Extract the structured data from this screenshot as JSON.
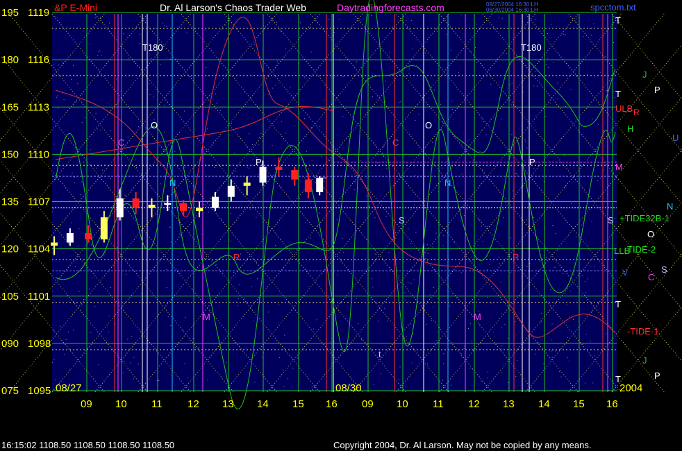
{
  "header": {
    "symbol": "&P E-Mini",
    "title": "Dr. Al Larson's Chaos Trader Web",
    "site": "Daytradingforecasts.com",
    "timestamp_1": "08/27/2004 16:30:LH",
    "timestamp_2": "08/30/2004 16:30:LH",
    "file": "spcctom.txt"
  },
  "footer": {
    "quote": "16:15:02  1108.50 1108.50 1108.50 1108.50",
    "copyright": "Copyright 2004, Dr. Al Larson. May not be copied by any means."
  },
  "colors": {
    "background": "#00005c",
    "price_up": "#ffffff",
    "price_down": "#ff2020",
    "price_yellow": "#ffff60",
    "green_line": "#20c020",
    "red_line": "#e03030",
    "yellow_grid": "#e0e060",
    "axis_text": "#ffff00"
  },
  "chart_data": {
    "type": "line",
    "title": "",
    "y_left_outer": [
      "195",
      "180",
      "165",
      "150",
      "135",
      "120",
      "105",
      "090",
      "075"
    ],
    "y_left_inner": [
      "1119",
      "1116",
      "1113",
      "1110",
      "1107",
      "1104",
      "1101",
      "1098",
      "1095"
    ],
    "ylim": [
      1095,
      1119
    ],
    "x_tick_labels": [
      "09",
      "10",
      "11",
      "12",
      "13",
      "14",
      "15",
      "16",
      "09",
      "10",
      "11",
      "12",
      "13",
      "14",
      "15",
      "16"
    ],
    "date_labels": [
      "08/27",
      "08/30",
      "2004"
    ],
    "legend_right": [
      {
        "text": "T",
        "color": "#ffffff"
      },
      {
        "text": "J",
        "color": "#20c020"
      },
      {
        "text": "P",
        "color": "#ffffff"
      },
      {
        "text": "T",
        "color": "#ffffff"
      },
      {
        "text": "ULB",
        "color": "#ff3030"
      },
      {
        "text": "R",
        "color": "#ff3030"
      },
      {
        "text": "H",
        "color": "#20e020"
      },
      {
        "text": "U",
        "color": "#4060ff"
      },
      {
        "text": "M",
        "color": "#ff40ff"
      },
      {
        "text": "N",
        "color": "#20c0ff"
      },
      {
        "text": "+TIDE32B-1",
        "color": "#20e020"
      },
      {
        "text": "O",
        "color": "#ffffff"
      },
      {
        "text": "LLB",
        "color": "#20e020"
      },
      {
        "text": "TIDE-2",
        "color": "#20e020"
      },
      {
        "text": "V",
        "color": "#4060ff"
      },
      {
        "text": "S",
        "color": "#c0c0ff"
      },
      {
        "text": "C",
        "color": "#ff40ff"
      },
      {
        "text": "T",
        "color": "#ffffff"
      },
      {
        "text": "-TIDE-1",
        "color": "#ff3030"
      },
      {
        "text": "J",
        "color": "#20c020"
      },
      {
        "text": "T",
        "color": "#ffffff"
      },
      {
        "text": "P",
        "color": "#ffffff"
      }
    ],
    "annotations": [
      "T180",
      "T180",
      "O",
      "O",
      "N",
      "N",
      "P",
      "P",
      "M",
      "M",
      "C",
      "C",
      "S",
      "S",
      "R",
      "R",
      "t"
    ],
    "series": [
      {
        "type": "candles",
        "values": [
          {
            "t": 0.0,
            "o": 1104.2,
            "h": 1104.8,
            "l": 1103.6,
            "c": 1104.4
          },
          {
            "t": 0.35,
            "o": 1104.4,
            "h": 1105.3,
            "l": 1104.2,
            "c": 1105.0
          },
          {
            "t": 0.75,
            "o": 1105.0,
            "h": 1105.5,
            "l": 1104.4,
            "c": 1104.6
          },
          {
            "t": 1.1,
            "o": 1104.6,
            "h": 1106.4,
            "l": 1104.4,
            "c": 1106.0
          },
          {
            "t": 1.45,
            "o": 1106.0,
            "h": 1107.8,
            "l": 1105.8,
            "c": 1107.2
          },
          {
            "t": 1.8,
            "o": 1107.2,
            "h": 1107.6,
            "l": 1106.2,
            "c": 1106.6
          },
          {
            "t": 2.15,
            "o": 1106.6,
            "h": 1107.2,
            "l": 1106.0,
            "c": 1106.8
          },
          {
            "t": 2.5,
            "o": 1106.8,
            "h": 1107.4,
            "l": 1106.4,
            "c": 1106.9
          },
          {
            "t": 2.85,
            "o": 1106.9,
            "h": 1107.1,
            "l": 1106.1,
            "c": 1106.4
          },
          {
            "t": 3.2,
            "o": 1106.4,
            "h": 1107.0,
            "l": 1106.0,
            "c": 1106.6
          },
          {
            "t": 3.55,
            "o": 1106.6,
            "h": 1107.6,
            "l": 1106.4,
            "c": 1107.3
          },
          {
            "t": 3.9,
            "o": 1107.3,
            "h": 1108.4,
            "l": 1107.0,
            "c": 1108.0
          },
          {
            "t": 4.25,
            "o": 1108.0,
            "h": 1108.6,
            "l": 1107.4,
            "c": 1108.2
          },
          {
            "t": 4.6,
            "o": 1108.2,
            "h": 1109.6,
            "l": 1108.0,
            "c": 1109.2
          },
          {
            "t": 4.95,
            "o": 1109.2,
            "h": 1109.8,
            "l": 1108.6,
            "c": 1109.0
          },
          {
            "t": 5.3,
            "o": 1109.0,
            "h": 1109.2,
            "l": 1108.0,
            "c": 1108.4
          },
          {
            "t": 5.6,
            "o": 1108.4,
            "h": 1108.8,
            "l": 1107.2,
            "c": 1107.6
          },
          {
            "t": 5.85,
            "o": 1107.6,
            "h": 1108.6,
            "l": 1107.4,
            "c": 1108.5
          }
        ]
      }
    ]
  }
}
